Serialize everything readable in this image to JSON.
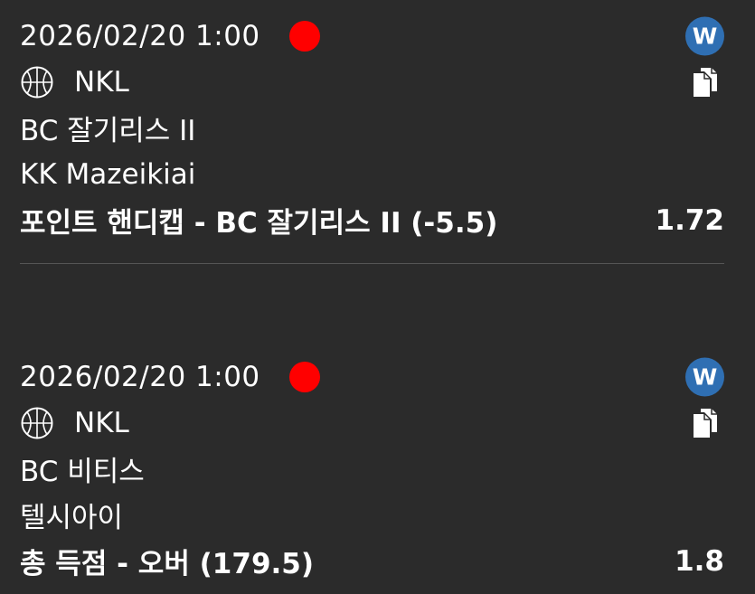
{
  "colors": {
    "background": "#2b2b2b",
    "text": "#ffffff",
    "live_dot": "#ff0000",
    "badge": "#2f6fb3",
    "divider": "#555555"
  },
  "bets": [
    {
      "datetime": "2026/02/20 1:00",
      "badge": "W",
      "sport_icon": "basketball-icon",
      "league": "NKL",
      "team1": "BC 잘기리스 II",
      "team2": "KK Mazeikiai",
      "market": "포인트 핸디캡 - BC 잘기리스 II (-5.5)",
      "odds": "1.72",
      "copy_icon": "copy-icon"
    },
    {
      "datetime": "2026/02/20 1:00",
      "badge": "W",
      "sport_icon": "basketball-icon",
      "league": "NKL",
      "team1": "BC 비티스",
      "team2": "텔시아이",
      "market": "총 득점 - 오버 (179.5)",
      "odds": "1.8",
      "copy_icon": "copy-icon"
    }
  ]
}
